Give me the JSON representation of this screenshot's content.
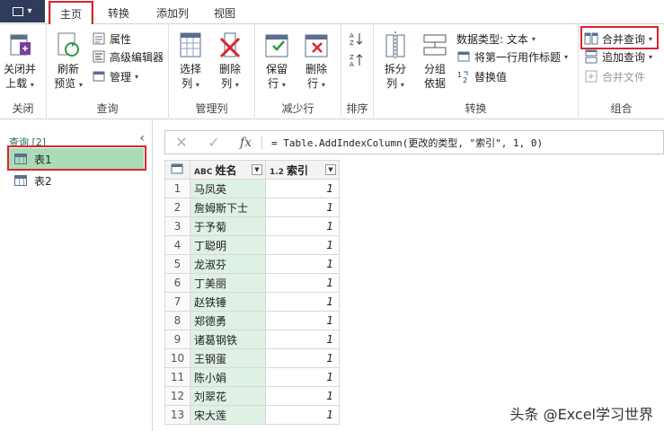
{
  "tabs": [
    {
      "label": "主页",
      "active": true
    },
    {
      "label": "转换"
    },
    {
      "label": "添加列"
    },
    {
      "label": "视图"
    }
  ],
  "ribbon": {
    "close": {
      "btn_line1": "关闭并",
      "btn_line2": "上载",
      "group": "关闭"
    },
    "query": {
      "refresh_line1": "刷新",
      "refresh_line2": "预览",
      "properties": "属性",
      "advanced_editor": "高级编辑器",
      "manage": "管理",
      "group": "查询"
    },
    "manage_columns": {
      "choose_line1": "选择",
      "choose_line2": "列",
      "remove_line1": "删除",
      "remove_line2": "列",
      "group": "管理列"
    },
    "reduce_rows": {
      "keep_line1": "保留",
      "keep_line2": "行",
      "remove_line1": "删除",
      "remove_line2": "行",
      "group": "减少行"
    },
    "sort": {
      "group": "排序"
    },
    "transform": {
      "split_line1": "拆分",
      "split_line2": "列",
      "groupby_line1": "分组",
      "groupby_line2": "依据",
      "data_type": "数据类型: 文本",
      "first_row_header": "将第一行用作标题",
      "replace_values": "替换值",
      "group": "转换"
    },
    "combine": {
      "merge_queries": "合并查询",
      "append_queries": "追加查询",
      "combine_files": "合并文件",
      "group": "组合"
    }
  },
  "left_pane": {
    "header": "查询 [2]",
    "items": [
      "表1",
      "表2"
    ]
  },
  "formula_bar": {
    "cancel": "✕",
    "confirm": "✓",
    "fx": "fx",
    "formula": "= Table.AddIndexColumn(更改的类型, \"索引\", 1, 0)"
  },
  "grid": {
    "col1_type": "ABC",
    "col1_name": "姓名",
    "col2_type": "1.2",
    "col2_name": "索引",
    "rows": [
      {
        "n": "1",
        "name": "马凤英",
        "idx": "1"
      },
      {
        "n": "2",
        "name": "詹姆斯下士",
        "idx": "1"
      },
      {
        "n": "3",
        "name": "于予菊",
        "idx": "1"
      },
      {
        "n": "4",
        "name": "丁聪明",
        "idx": "1"
      },
      {
        "n": "5",
        "name": "龙淑芬",
        "idx": "1"
      },
      {
        "n": "6",
        "name": "丁美丽",
        "idx": "1"
      },
      {
        "n": "7",
        "name": "赵铁锤",
        "idx": "1"
      },
      {
        "n": "8",
        "name": "郑德勇",
        "idx": "1"
      },
      {
        "n": "9",
        "name": "诸葛钢铁",
        "idx": "1"
      },
      {
        "n": "10",
        "name": "王钢蛋",
        "idx": "1"
      },
      {
        "n": "11",
        "name": "陈小娟",
        "idx": "1"
      },
      {
        "n": "12",
        "name": "刘翠花",
        "idx": "1"
      },
      {
        "n": "13",
        "name": "宋大莲",
        "idx": "1"
      }
    ]
  },
  "watermark": "头条 @Excel学习世界",
  "colors": {
    "highlight_red": "#d9262e",
    "selection_green": "#a9dcb7",
    "column_green": "#dff0e5",
    "file_button": "#2f3b5a"
  }
}
